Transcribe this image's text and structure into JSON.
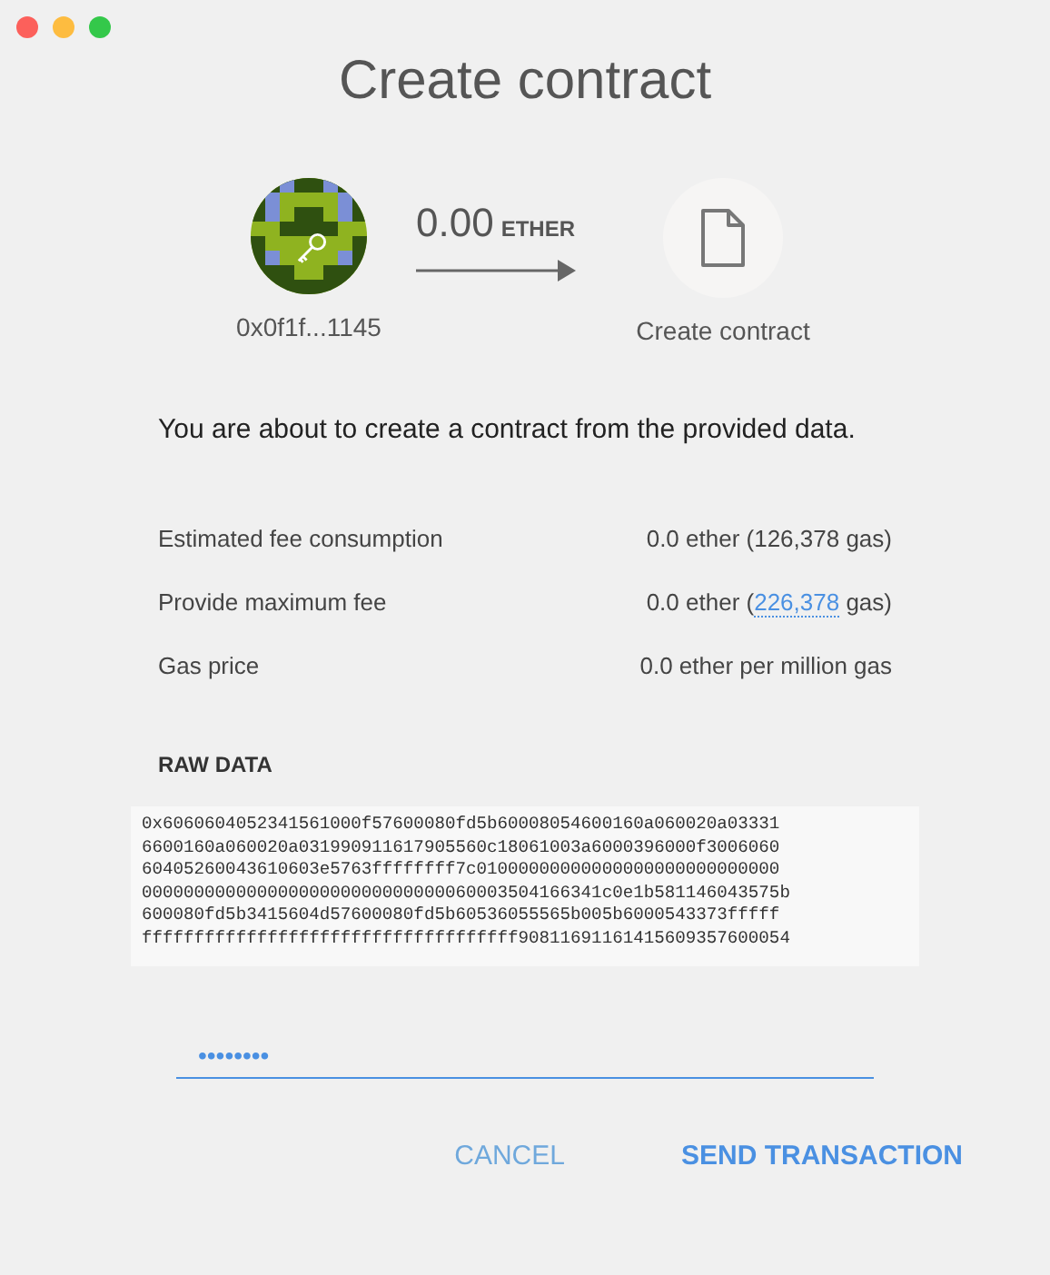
{
  "window": {
    "title": "Create contract"
  },
  "transfer": {
    "from": "0x0f1f...1145",
    "amount": "0.00",
    "unit": "ETHER",
    "to": "Create contract"
  },
  "message": "You are about to create a contract from the provided data.",
  "fees": [
    {
      "label": "Estimated fee consumption",
      "value_before": "0.0 ether (126,378 gas)"
    },
    {
      "label": "Provide maximum fee",
      "value_before": "0.0 ether (",
      "link": "226,378",
      "value_after": " gas)"
    },
    {
      "label": "Gas price",
      "value_before": "0.0 ether per million gas"
    }
  ],
  "raw_data": {
    "heading": "RAW DATA",
    "lines": [
      "0x6060604052341561000f57600080fd5b60008054600160a060020a03331",
      "6600160a060020a031990911617905560c18061003a6000396000f3006060",
      "60405260043610603e5763ffffffff7c01000000000000000000000000000",
      "00000000000000000000000000000060003504166341c0e1b581146043575b",
      "600080fd5b3415604d57600080fd5b60536055565b005b6000543373fffff",
      "ffffffffffffffffffffffffffffffffffff90811691161415609357600054"
    ]
  },
  "password": {
    "value": "••••••••"
  },
  "buttons": [
    {
      "label": "CANCEL",
      "kind": "secondary"
    },
    {
      "label": "SEND TRANSACTION",
      "kind": "primary"
    }
  ]
}
